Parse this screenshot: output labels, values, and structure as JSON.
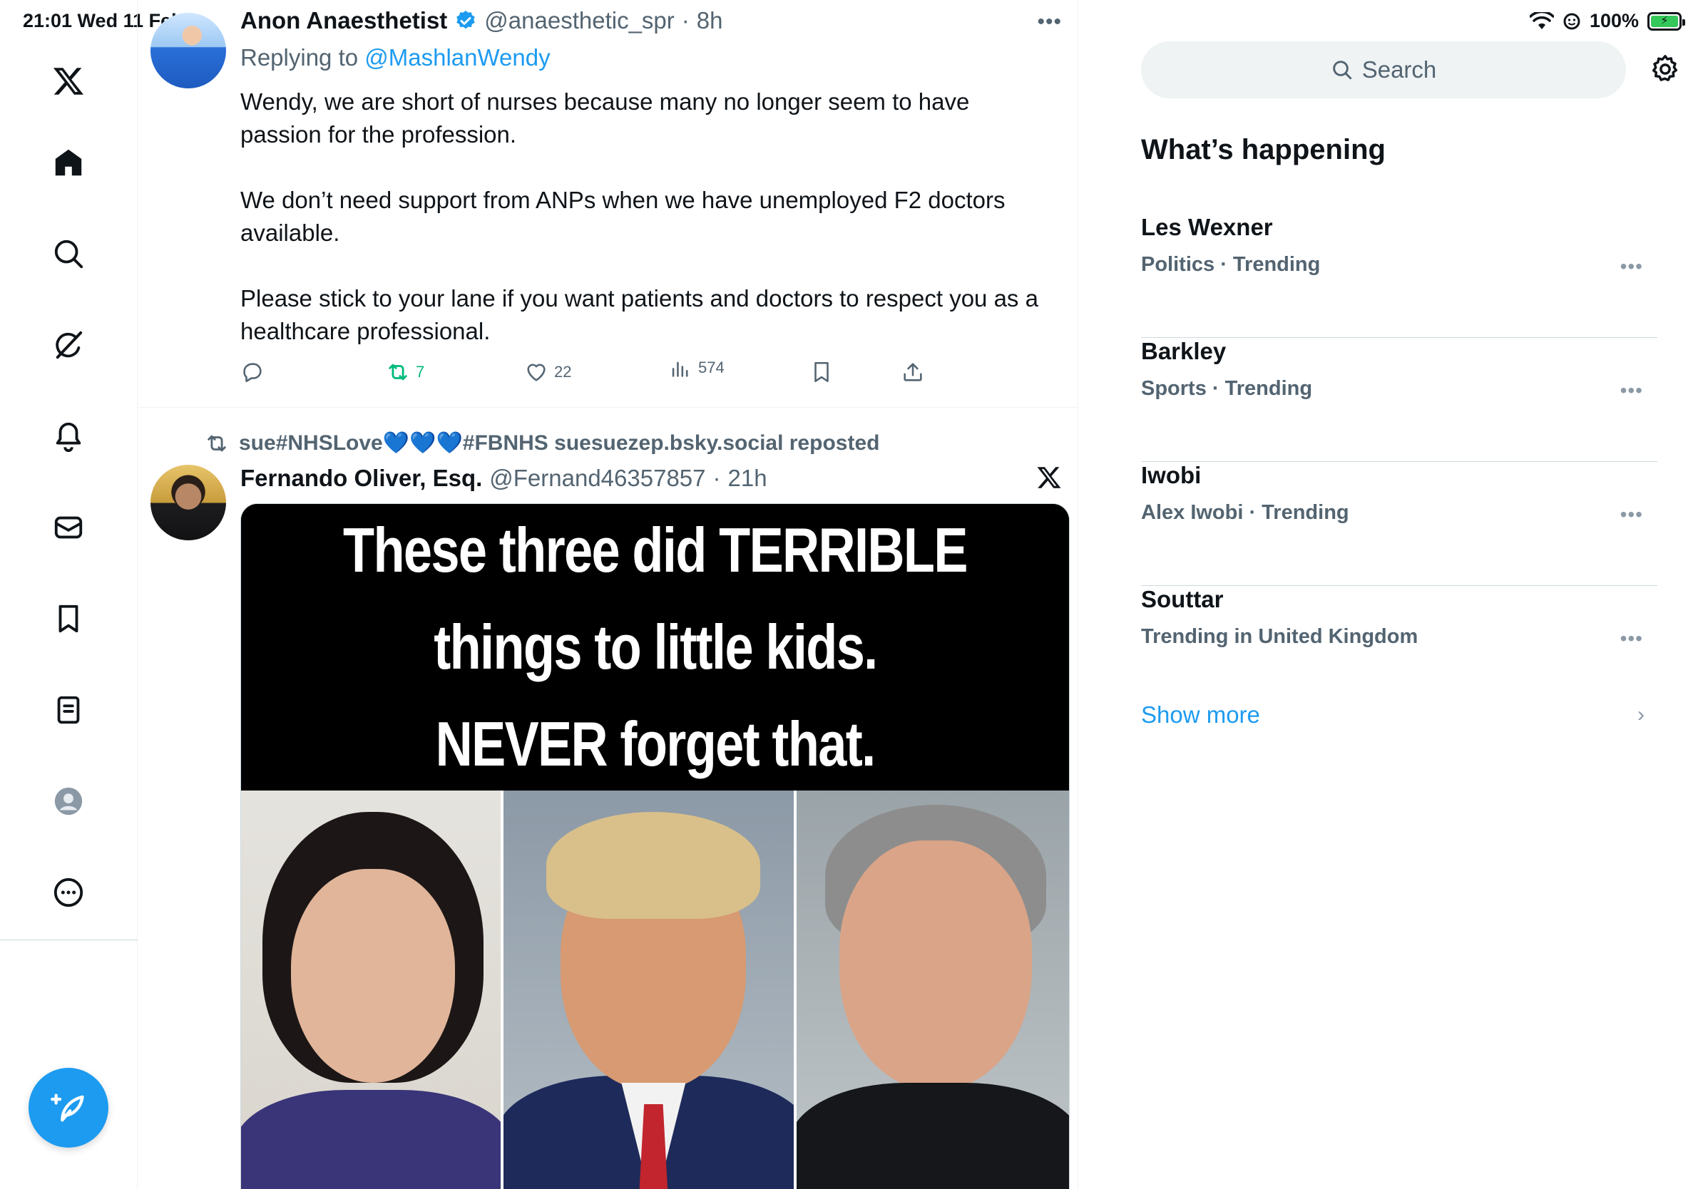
{
  "status_bar": {
    "time_date": "21:01   Wed 11 Feb",
    "battery": "100%"
  },
  "nav": {
    "items": [
      "x-logo-icon",
      "home-icon",
      "search-icon",
      "grok-icon",
      "notifications-icon",
      "messages-icon",
      "bookmarks-icon",
      "lists-icon",
      "profile-icon",
      "more-icon"
    ]
  },
  "tweet1": {
    "author_name": "Anon Anaesthetist",
    "author_handle": "@anaesthetic_spr",
    "time": "8h",
    "replying_to_prefix": "Replying to ",
    "replying_to_handle": "@MashlanWendy",
    "paragraphs": [
      "Wendy, we are short of nurses because many no longer seem to have passion for the profession.",
      "We don’t need support from ANPs when we have unemployed F2 doctors available.",
      "Please stick to your lane if you want patients and doctors to respect you as a healthcare professional."
    ],
    "retweets": "7",
    "likes": "22",
    "views": "574"
  },
  "tweet2": {
    "reposted_by": "sue#NHSLove💙💙💙#FBNHS suesuezep.bsky.social reposted",
    "author_name": "Fernando Oliver, Esq.",
    "author_handle": "@Fernand46357857",
    "time": "21h",
    "media_caption_lines": [
      "These three did TERRIBLE",
      "things to little kids.",
      "NEVER forget that."
    ]
  },
  "sidebar": {
    "search_placeholder": "Search",
    "section_title": "What’s happening",
    "trends": [
      {
        "name": "Les Wexner",
        "meta": "Politics · Trending"
      },
      {
        "name": "Barkley",
        "meta": "Sports · Trending"
      },
      {
        "name": "Iwobi",
        "meta": "Alex Iwobi · Trending"
      },
      {
        "name": "Souttar",
        "meta": "Trending in United Kingdom"
      }
    ],
    "show_more": "Show more"
  },
  "colors": {
    "accent": "#1d9bf0",
    "retweet_green": "#00ba7c",
    "secondary_text": "#536471"
  }
}
